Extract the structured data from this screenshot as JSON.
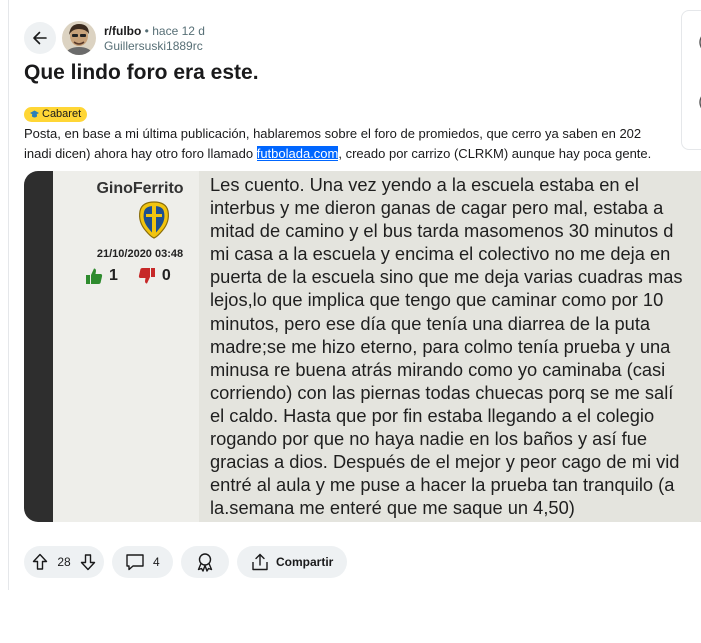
{
  "post": {
    "subreddit": "r/fulbo",
    "separator": "•",
    "age": "hace 12 d",
    "author": "Guillersuski1889rc",
    "title": "Que lindo foro era este.",
    "flair": "Cabaret",
    "flair_color": "#ffd635",
    "body_line1": "Posta, en base a mi última publicación, hablaremos sobre el foro de promiedos, que cerro ya saben en 202",
    "body_line2_pre": "inadi dicen) ahora hay otro foro llamado ",
    "body_line2_link": "futbolada.com",
    "body_line2_post": ", creado por carrizo (CLRKM) aunque hay poca gente."
  },
  "image": {
    "poster_name": "GinoFerrito",
    "date": "21/10/2020 03:48",
    "upvotes": "1",
    "downvotes": "0",
    "story_lines": [
      "Les cuento. Una vez yendo a la escuela estaba en el",
      "interbus y me dieron ganas de cagar pero mal, estaba a",
      "mitad de camino y el bus tarda masomenos 30 minutos d",
      "mi casa a la escuela y encima el colectivo no me deja en",
      "puerta de la escuela sino que me deja varias cuadras mas",
      "lejos,lo que implica que tengo que caminar como por 10",
      "minutos, pero ese día que tenía una diarrea de la puta",
      "madre;se me hizo eterno, para colmo tenía prueba y una",
      "minusa re buena atrás mirando como yo caminaba (casi",
      "corriendo) con las piernas todas chuecas porq se me salí",
      "el caldo. Hasta que por fin estaba llegando a el colegio",
      "rogando por que no haya nadie en los baños y así fue",
      "gracias a dios. Después de el mejor y peor cago de mi vid",
      "entré al aula y me puse a hacer la prueba tan tranquilo (a",
      "la.semana me enteré que me saque un 4,50)"
    ]
  },
  "actions": {
    "score": "28",
    "comments": "4",
    "share": "Compartir"
  },
  "side": {
    "glyph_top": "(",
    "glyph_bottom": "("
  },
  "colors": {
    "accent_selection": "#0066ff",
    "button_bg": "#eef1f3",
    "upvote_green": "#2e8b2e",
    "downvote_red": "#c62828"
  }
}
